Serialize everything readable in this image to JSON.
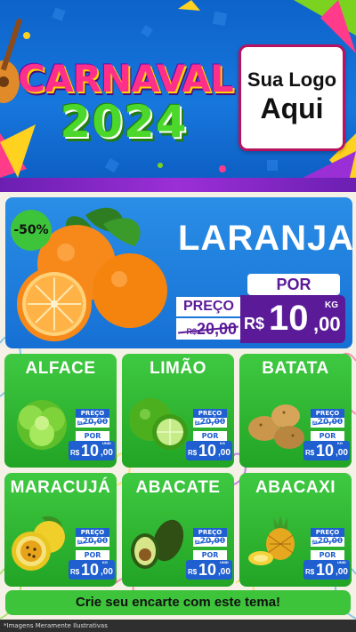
{
  "header": {
    "title_line1": "CARNAVAL",
    "title_line2": "2024",
    "logo_line1": "Sua Logo",
    "logo_line2": "Aqui"
  },
  "colors": {
    "header_blue": "#1777dd",
    "purple": "#5b1b99",
    "card_green": "#3fc941",
    "price_blue": "#1f5fcf"
  },
  "featured": {
    "discount": "-50%",
    "name": "LARANJA",
    "old_label": "PREÇO",
    "old_currency": "R$",
    "old_price": "20,00",
    "new_label": "POR",
    "currency": "R$",
    "price_int": "10",
    "price_dec": ",00",
    "unit": "KG",
    "image_icon": "orange-fruit-icon"
  },
  "products": [
    {
      "name": "ALFACE",
      "old_label": "PREÇO",
      "old_currency": "R$",
      "old_price": "20,00",
      "new_label": "POR",
      "currency": "R$",
      "price_int": "10",
      "price_dec": ",00",
      "unit": "UNID",
      "image_icon": "lettuce-icon"
    },
    {
      "name": "LIMÃO",
      "old_label": "PREÇO",
      "old_currency": "R$",
      "old_price": "20,00",
      "new_label": "POR",
      "currency": "R$",
      "price_int": "10",
      "price_dec": ",00",
      "unit": "KG",
      "image_icon": "lime-icon"
    },
    {
      "name": "BATATA",
      "old_label": "PREÇO",
      "old_currency": "R$",
      "old_price": "20,00",
      "new_label": "POR",
      "currency": "R$",
      "price_int": "10",
      "price_dec": ",00",
      "unit": "KG",
      "image_icon": "potato-icon"
    },
    {
      "name": "MARACUJÁ",
      "old_label": "PREÇO",
      "old_currency": "R$",
      "old_price": "20,00",
      "new_label": "POR",
      "currency": "R$",
      "price_int": "10",
      "price_dec": ",00",
      "unit": "KG",
      "image_icon": "passion-fruit-icon"
    },
    {
      "name": "ABACATE",
      "old_label": "PREÇO",
      "old_currency": "R$",
      "old_price": "20,00",
      "new_label": "POR",
      "currency": "R$",
      "price_int": "10",
      "price_dec": ",00",
      "unit": "UNID",
      "image_icon": "avocado-icon"
    },
    {
      "name": "ABACAXI",
      "old_label": "PREÇO",
      "old_currency": "R$",
      "old_price": "20,00",
      "new_label": "POR",
      "currency": "R$",
      "price_int": "10",
      "price_dec": ",00",
      "unit": "UNID",
      "image_icon": "pineapple-icon"
    }
  ],
  "footer": {
    "cta": "Crie seu encarte com este tema!",
    "disclaimer": "*Imagens Meramente Ilustrativas"
  }
}
